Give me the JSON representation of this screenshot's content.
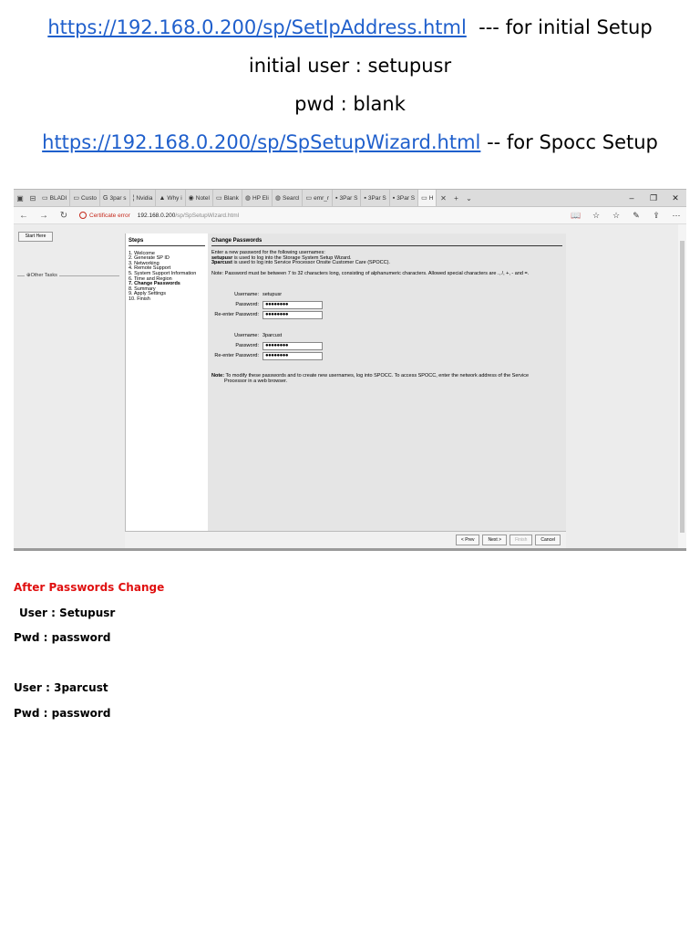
{
  "doc": {
    "line1_link": "https://192.168.0.200/sp/SetIpAddress.html",
    "line1_suffix": "--- for initial Setup",
    "line2": "initial user  : setupusr",
    "line3": "pwd : blank",
    "line4_link": "https://192.168.0.200/sp/SpSetupWizard.html",
    "line4_suffix": "-- for Spocc Setup"
  },
  "browser": {
    "tabs": [
      {
        "icon": "doc-icon",
        "glyph": "▭",
        "label": "BLADI"
      },
      {
        "icon": "doc-icon",
        "glyph": "▭",
        "label": "Custo"
      },
      {
        "icon": "google-icon",
        "glyph": "G",
        "label": "3par s"
      },
      {
        "icon": "nvidia-icon",
        "glyph": "¦",
        "label": "Nvidia"
      },
      {
        "icon": "why-icon",
        "glyph": "▲",
        "label": "Why i"
      },
      {
        "icon": "notes-icon",
        "glyph": "◉",
        "label": "Notel"
      },
      {
        "icon": "doc-icon",
        "glyph": "▭",
        "label": "Blank"
      },
      {
        "icon": "hp-icon",
        "glyph": "◍",
        "label": "HP Eli"
      },
      {
        "icon": "search-icon",
        "glyph": "◍",
        "label": "Searcl"
      },
      {
        "icon": "doc-icon",
        "glyph": "▭",
        "label": "emr_r"
      },
      {
        "icon": "3par-icon",
        "glyph": "▪",
        "label": "3Par S"
      },
      {
        "icon": "3par-icon",
        "glyph": "▪",
        "label": "3Par S"
      },
      {
        "icon": "3par-icon",
        "glyph": "▪",
        "label": "3Par S"
      },
      {
        "icon": "doc-icon",
        "glyph": "▭",
        "label": "H"
      }
    ],
    "cert_error": "Certificate error",
    "url_host": "192.168.0.200",
    "url_path": "/sp/SpSetupWizard.html"
  },
  "wizard": {
    "start_here": "Start Here",
    "other_tasks": "Other Tasks",
    "steps_title": "Steps",
    "steps": [
      {
        "num": "1.",
        "label": "Welcome"
      },
      {
        "num": "2.",
        "label": "Generate SP ID"
      },
      {
        "num": "3.",
        "label": "Networking"
      },
      {
        "num": "4.",
        "label": "Remote Support"
      },
      {
        "num": "5.",
        "label": "System Support Information"
      },
      {
        "num": "6.",
        "label": "Time and Region"
      },
      {
        "num": "7.",
        "label": "Change Passwords"
      },
      {
        "num": "8.",
        "label": "Summary"
      },
      {
        "num": "9.",
        "label": "Apply Settings"
      },
      {
        "num": "10.",
        "label": "Finish"
      }
    ],
    "current_step_index": 6,
    "title": "Change Passwords",
    "intro": "Enter a new password for the following usernames:",
    "intro_user1_name": "setupusr",
    "intro_user1_desc": "is used to log into the Storage System Setup Wizard.",
    "intro_user2_name": "3parcust",
    "intro_user2_desc": "is used to log into Service Processor Onsite Customer Care (SPOCC).",
    "pw_note": "Note: Password must be between 7 to 32 characters long, consisting of alphanumeric characters. Allowed special characters are ., /, +, - and =.",
    "label_username": "Username:",
    "label_password": "Password:",
    "label_reenter": "Re-enter Password:",
    "user1": "setupusr",
    "user2": "3parcust",
    "masked": "●●●●●●●●",
    "footnote_label": "Note:",
    "footnote_line1": "To modify these passwords and to create new usernames, log into SPOCC. To access SPOCC, enter the network address of the Service",
    "footnote_line2": "Processor in a web browser.",
    "btn_prev": "< Prev",
    "btn_next": "Next >",
    "btn_finish": "Finish",
    "btn_cancel": "Cancel"
  },
  "notes": {
    "heading": "After Passwords Change",
    "user1_line": "User : Setupusr",
    "pwd1_line": "Pwd : password",
    "user2_line": "User : 3parcust",
    "pwd2_line": "Pwd : password"
  }
}
